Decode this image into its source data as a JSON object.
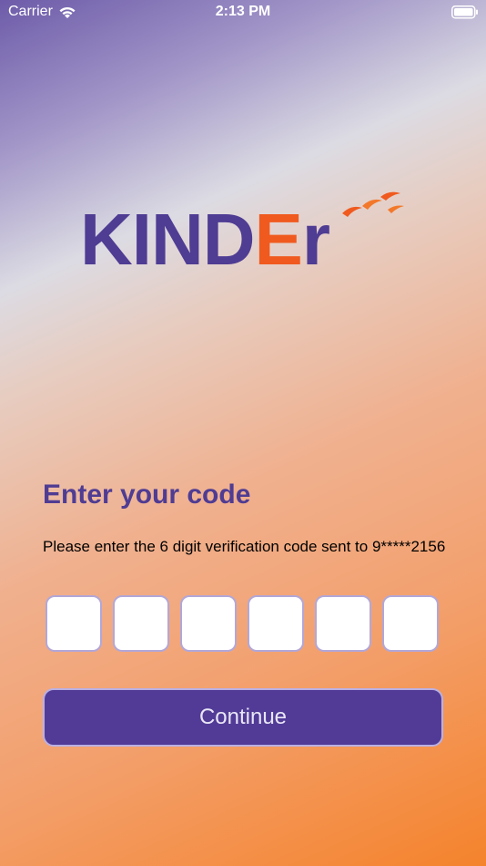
{
  "status_bar": {
    "carrier": "Carrier",
    "time": "2:13 PM"
  },
  "logo": {
    "part_purple": "KIND",
    "part_orange_e": "E",
    "part_purple_r": "r",
    "brand_purple": "#4f3c93",
    "brand_orange": "#f05a1e"
  },
  "verification": {
    "heading": "Enter your code",
    "instructions": "Please enter the 6 digit verification code sent to 9*****2156",
    "code_boxes": [
      "",
      "",
      "",
      "",
      "",
      ""
    ]
  },
  "actions": {
    "continue_label": "Continue"
  },
  "colors": {
    "accent": "#523b97",
    "box_border": "#b2a7d8"
  }
}
